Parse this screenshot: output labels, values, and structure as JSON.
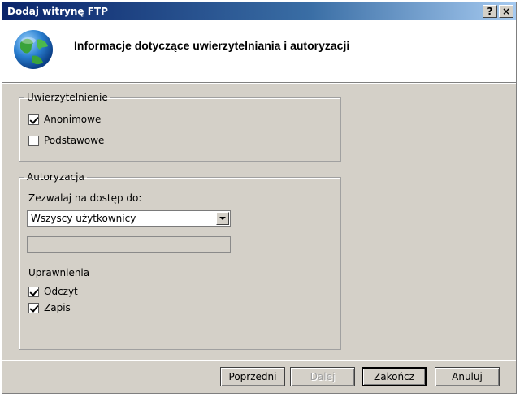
{
  "window": {
    "title": "Dodaj witrynę FTP",
    "help_glyph": "?",
    "close_glyph": "×"
  },
  "header": {
    "title": "Informacje dotyczące uwierzytelniania i autoryzacji",
    "icon": "globe-icon"
  },
  "authentication": {
    "legend": "Uwierzytelnienie",
    "anonymous": {
      "label": "Anonimowe",
      "checked": true
    },
    "basic": {
      "label": "Podstawowe",
      "checked": false
    }
  },
  "authorization": {
    "legend": "Autoryzacja",
    "access_label": "Zezwalaj na dostęp do:",
    "access_value": "Wszyscy użytkownicy",
    "user_field_value": "",
    "permissions_label": "Uprawnienia",
    "read": {
      "label": "Odczyt",
      "checked": true
    },
    "write": {
      "label": "Zapis",
      "checked": true
    }
  },
  "buttons": {
    "previous": "Poprzedni",
    "next": "Dalej",
    "finish": "Zakończ",
    "cancel": "Anuluj"
  }
}
